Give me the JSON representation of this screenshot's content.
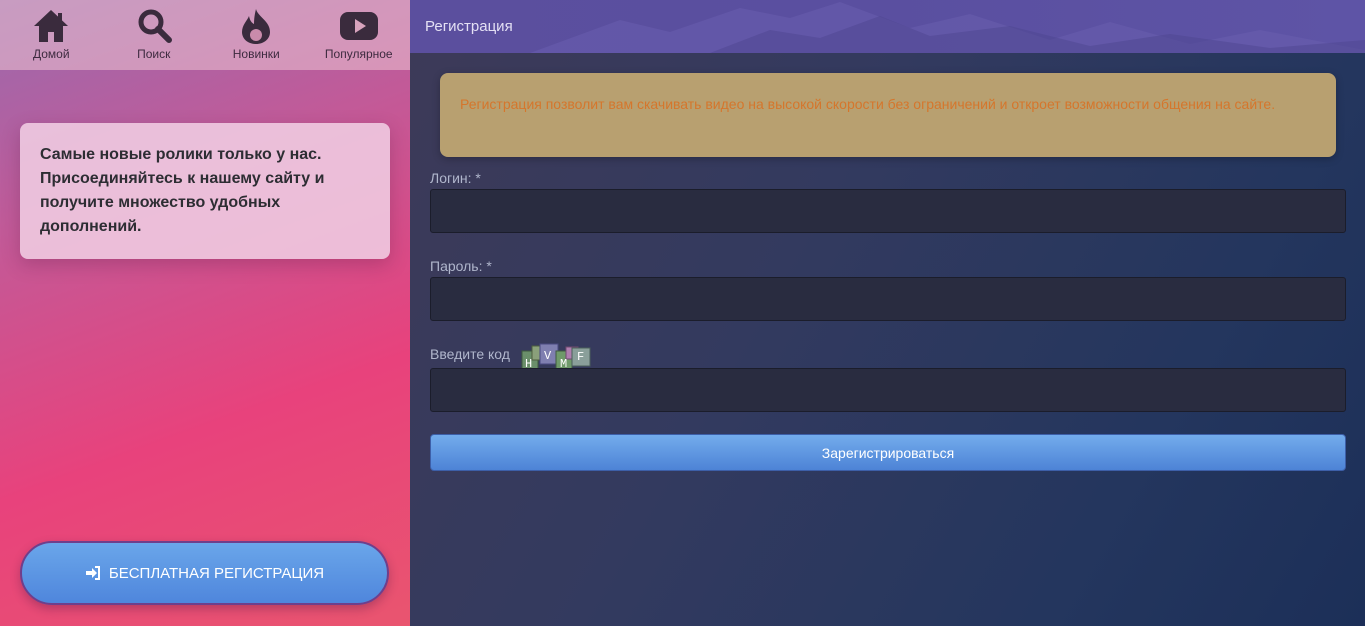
{
  "nav": {
    "items": [
      {
        "label": "Домой",
        "icon": "home-icon"
      },
      {
        "label": "Поиск",
        "icon": "search-icon"
      },
      {
        "label": "Новинки",
        "icon": "flame-icon"
      },
      {
        "label": "Популярное",
        "icon": "youtube-icon"
      }
    ]
  },
  "promo": {
    "text": "Самые новые ролики только у нас. Присоединяйтесь к нашему сайту и получите множество удобных дополнений."
  },
  "free_registration": {
    "label": "БЕСПЛАТНАЯ РЕГИСТРАЦИЯ",
    "icon": "sign-in-icon"
  },
  "header": {
    "title": "Регистрация"
  },
  "notice": {
    "text": "Регистрация позволит вам скачивать видео на высокой скорости без ограничений и откроет возможности общения на сайте."
  },
  "form": {
    "login_label": "Логин: *",
    "login_value": "",
    "password_label": "Пароль: *",
    "password_value": "",
    "captcha_label": "Введите код",
    "captcha_code": [
      "H",
      "V",
      "M",
      "F"
    ],
    "captcha_value": "",
    "submit_label": "Зарегистрироваться"
  },
  "colors": {
    "notice_bg": "#b8a070",
    "notice_text": "#d5762c",
    "button_blue": "#4f86dc",
    "header_purple": "#5b4f9e"
  }
}
